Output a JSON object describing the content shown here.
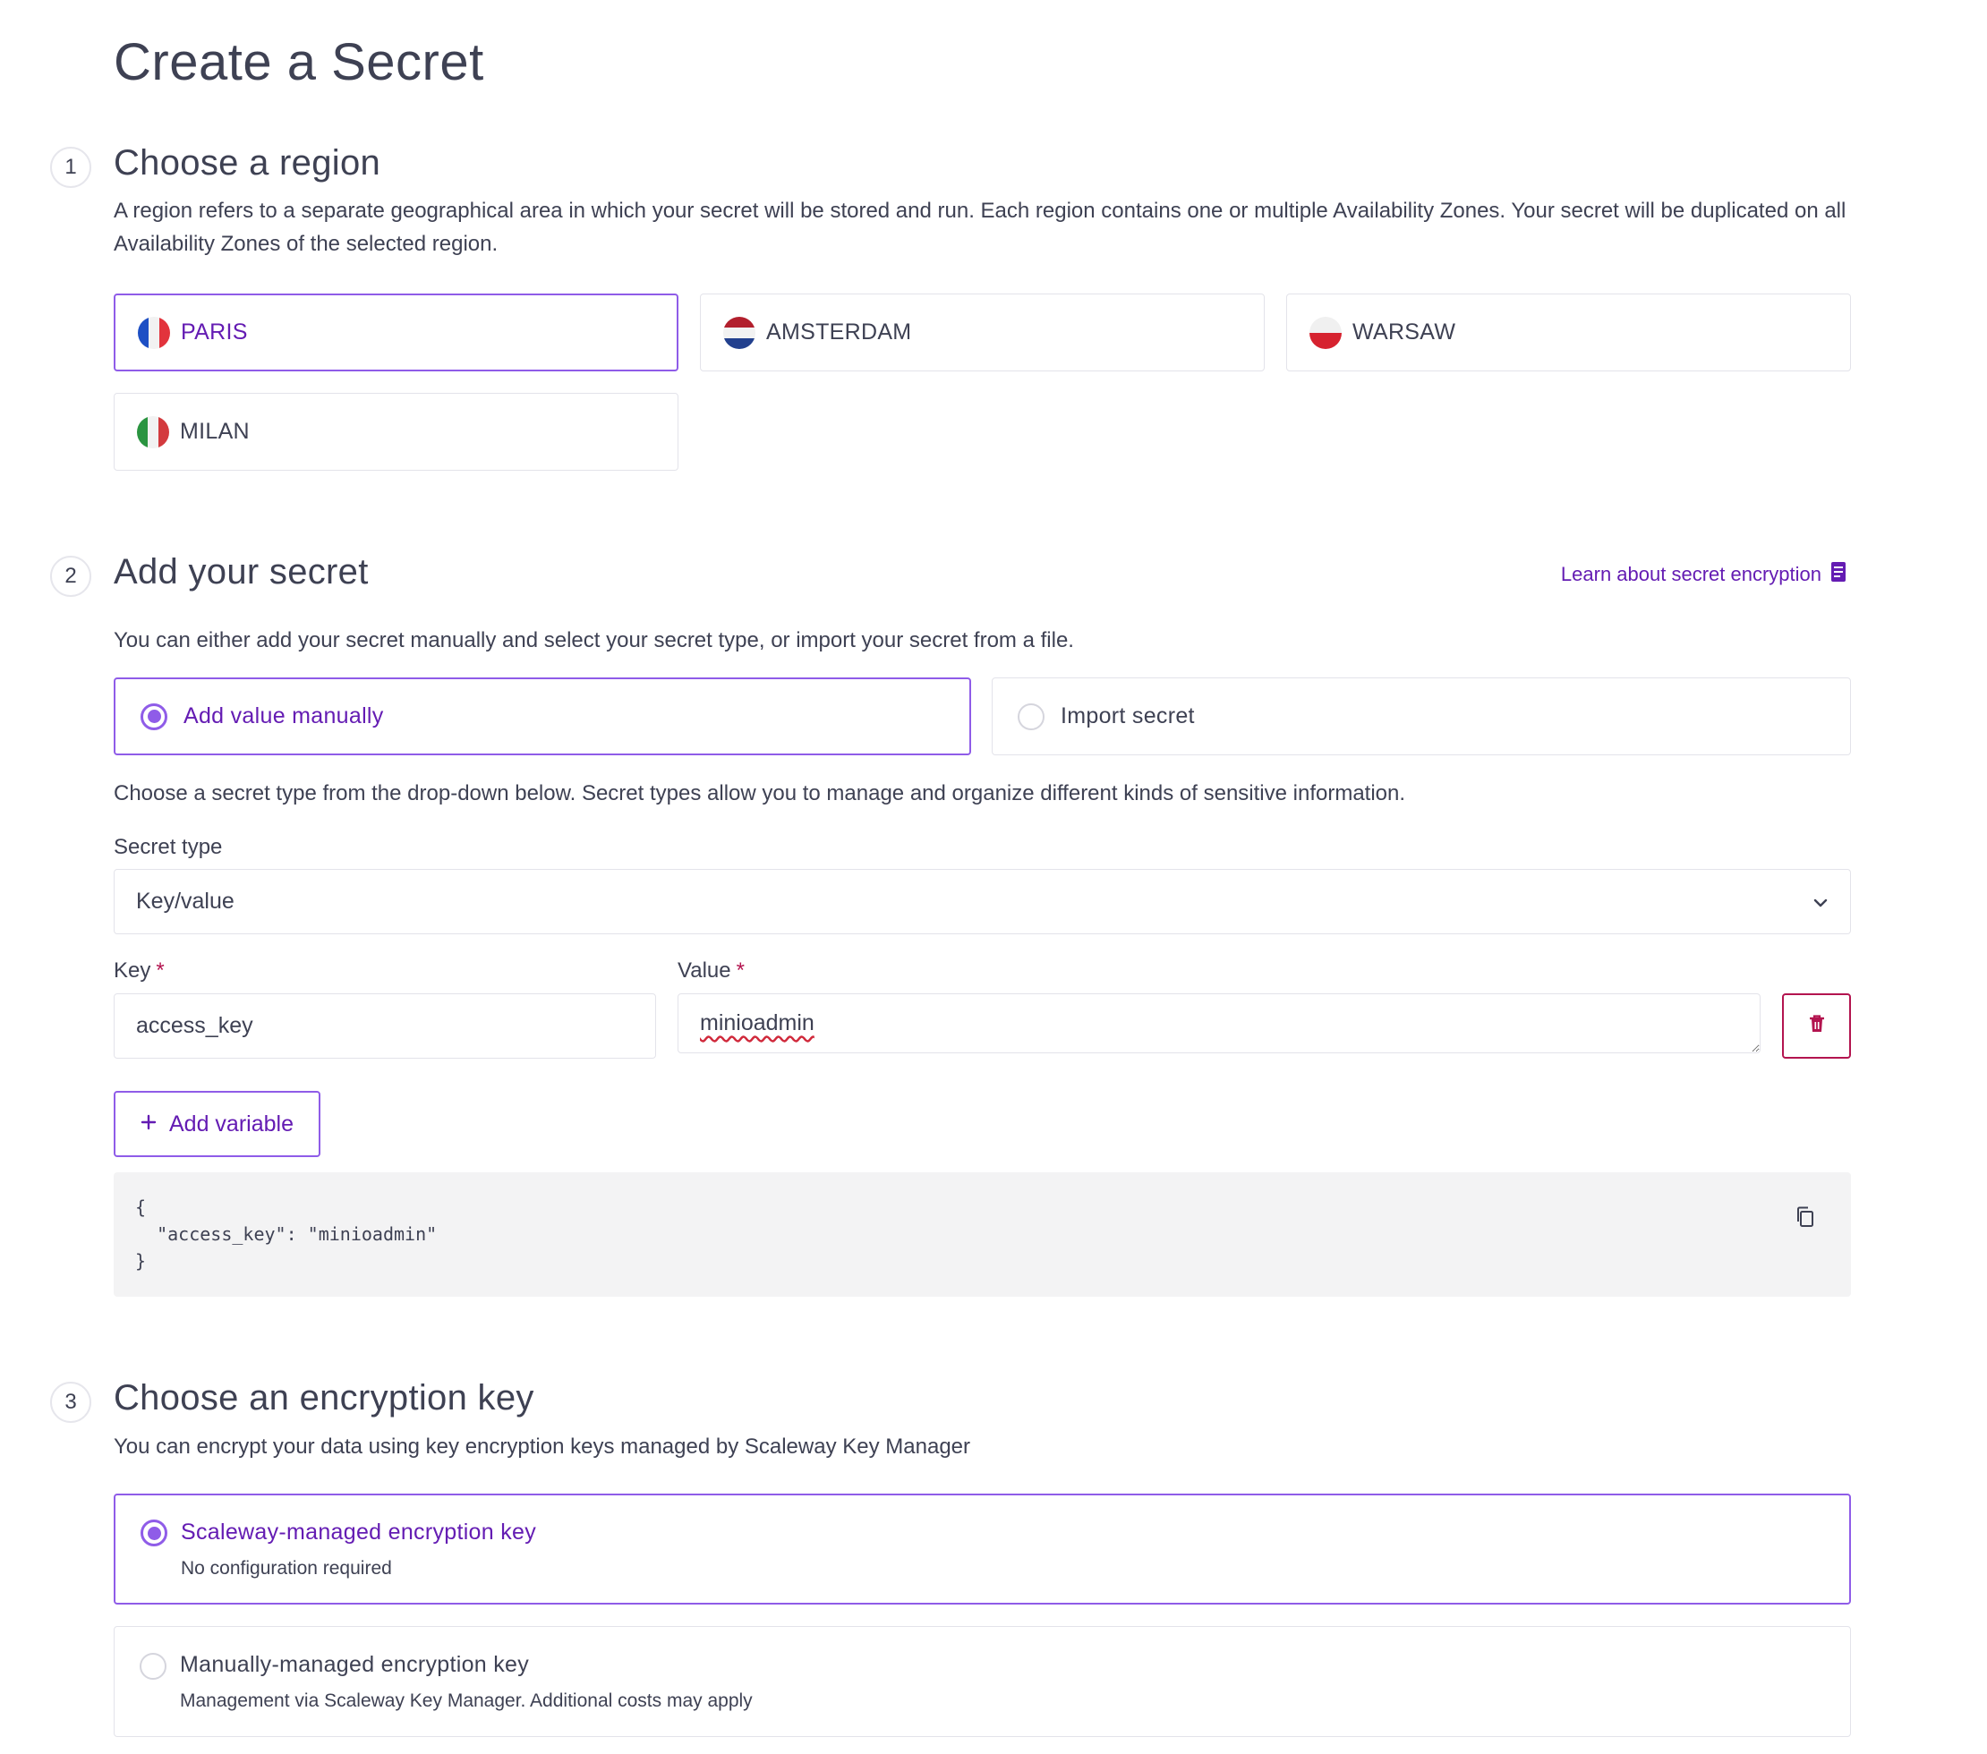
{
  "page": {
    "title": "Create a Secret"
  },
  "steps": {
    "region": {
      "number": "1",
      "title": "Choose a region",
      "description": "A region refers to a separate geographical area in which your secret will be stored and run. Each region contains one or multiple Availability Zones. Your secret will be duplicated on all Availability Zones of the selected region.",
      "options": [
        {
          "label": "PARIS",
          "icon": "france-flag-icon",
          "selected": true
        },
        {
          "label": "AMSTERDAM",
          "icon": "netherlands-flag-icon",
          "selected": false
        },
        {
          "label": "WARSAW",
          "icon": "poland-flag-icon",
          "selected": false
        },
        {
          "label": "MILAN",
          "icon": "italy-flag-icon",
          "selected": false
        }
      ]
    },
    "secret": {
      "number": "2",
      "title": "Add your secret",
      "learn_link": "Learn about secret encryption",
      "learn_icon": "document-icon",
      "description": "You can either add your secret manually and select your secret type, or import your secret from a file.",
      "modes": [
        {
          "label": "Add value manually",
          "checked": true
        },
        {
          "label": "Import secret",
          "checked": false
        }
      ],
      "type_description": "Choose a secret type from the drop-down below. Secret types allow you to manage and organize different kinds of sensitive information.",
      "type_label": "Secret type",
      "type_value": "Key/value",
      "key_label": "Key",
      "value_label": "Value",
      "required_mark": "*",
      "key_value": "access_key",
      "value_value": "minioadmin",
      "add_variable": "Add variable",
      "add_icon": "plus-icon",
      "delete_icon": "trash-icon",
      "copy_icon": "copy-icon",
      "json_preview": "{\n  \"access_key\": \"minioadmin\"\n}"
    },
    "encryption": {
      "number": "3",
      "title": "Choose an encryption key",
      "description": "You can encrypt your data using key encryption keys managed by Scaleway Key Manager",
      "options": [
        {
          "label": "Scaleway-managed encryption key",
          "sub": "No configuration required",
          "checked": true
        },
        {
          "label": "Manually-managed encryption key",
          "sub": "Management via Scaleway Key Manager. Additional costs may apply",
          "checked": false
        }
      ]
    }
  },
  "colors": {
    "accent": "#8f5ce8",
    "accent_text": "#641cb3",
    "danger": "#b3144f",
    "border": "#e3e3ea"
  }
}
